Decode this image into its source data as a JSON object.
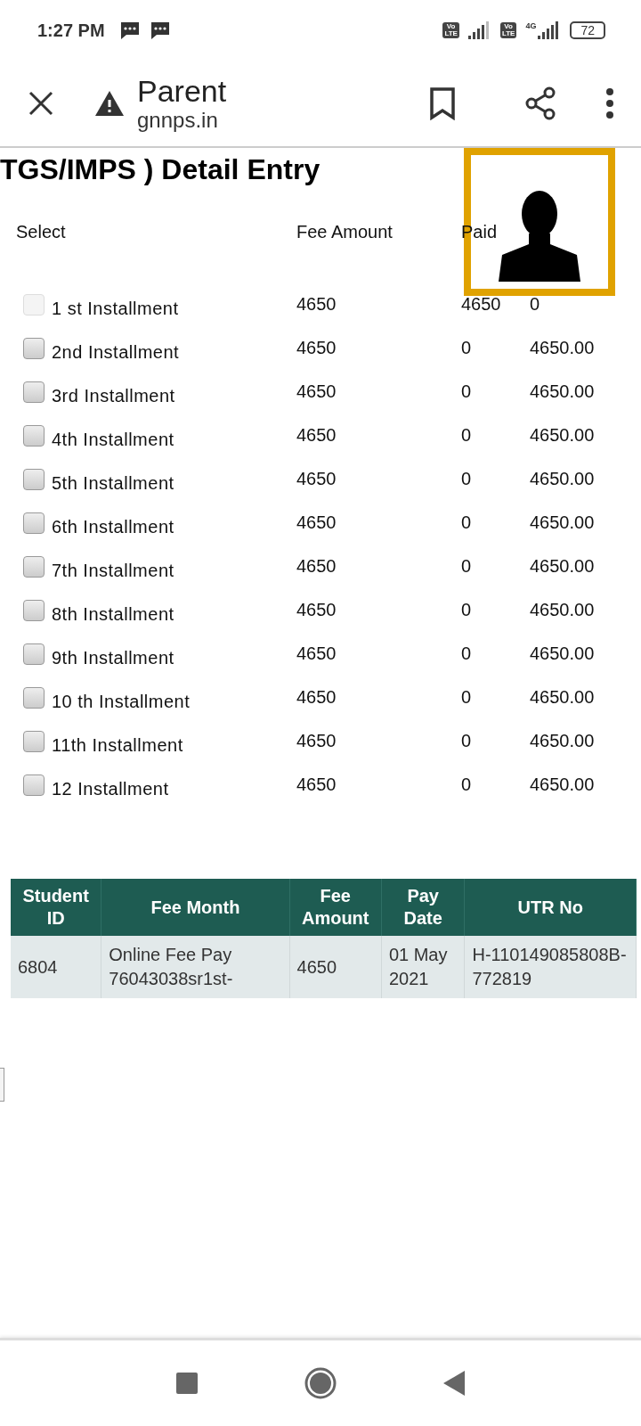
{
  "status_bar": {
    "time": "1:27 PM",
    "sims": [
      {
        "badge_top": "Vo",
        "badge_bottom": "LTE"
      },
      {
        "badge_top": "Vo",
        "badge_bottom": "LTE",
        "network": "4G"
      }
    ],
    "battery": "72"
  },
  "toolbar": {
    "title": "Parent",
    "url": "gnnps.in"
  },
  "page": {
    "heading": "TGS/IMPS ) Detail Entry",
    "columns": [
      "Select",
      "Fee Amount",
      "Paid"
    ],
    "installments": [
      {
        "label": "1 st Installment",
        "fee": "4650",
        "paid": "4650",
        "due": "0",
        "checked": false,
        "disabled": true
      },
      {
        "label": "2nd Installment",
        "fee": "4650",
        "paid": "0",
        "due": "4650.00",
        "checked": false,
        "disabled": false
      },
      {
        "label": "3rd Installment",
        "fee": "4650",
        "paid": "0",
        "due": "4650.00",
        "checked": false,
        "disabled": false
      },
      {
        "label": "4th Installment",
        "fee": "4650",
        "paid": "0",
        "due": "4650.00",
        "checked": false,
        "disabled": false
      },
      {
        "label": "5th Installment",
        "fee": "4650",
        "paid": "0",
        "due": "4650.00",
        "checked": false,
        "disabled": false
      },
      {
        "label": "6th Installment",
        "fee": "4650",
        "paid": "0",
        "due": "4650.00",
        "checked": false,
        "disabled": false
      },
      {
        "label": "7th Installment",
        "fee": "4650",
        "paid": "0",
        "due": "4650.00",
        "checked": false,
        "disabled": false
      },
      {
        "label": "8th Installment",
        "fee": "4650",
        "paid": "0",
        "due": "4650.00",
        "checked": false,
        "disabled": false
      },
      {
        "label": "9th Installment",
        "fee": "4650",
        "paid": "0",
        "due": "4650.00",
        "checked": false,
        "disabled": false
      },
      {
        "label": "10 th Installment",
        "fee": "4650",
        "paid": "0",
        "due": "4650.00",
        "checked": false,
        "disabled": false
      },
      {
        "label": "11th Installment",
        "fee": "4650",
        "paid": "0",
        "due": "4650.00",
        "checked": false,
        "disabled": false
      },
      {
        "label": "12 Installment",
        "fee": "4650",
        "paid": "0",
        "due": "4650.00",
        "checked": false,
        "disabled": false
      }
    ],
    "table": {
      "columns": [
        "Student ID",
        "Fee Month",
        "Fee Amount",
        "Pay Date",
        "UTR No"
      ],
      "rows": [
        [
          "6804",
          "Online Fee Pay 76043038sr1st-",
          "4650",
          "01 May 2021",
          "H-110149085808B-772819"
        ]
      ]
    }
  }
}
